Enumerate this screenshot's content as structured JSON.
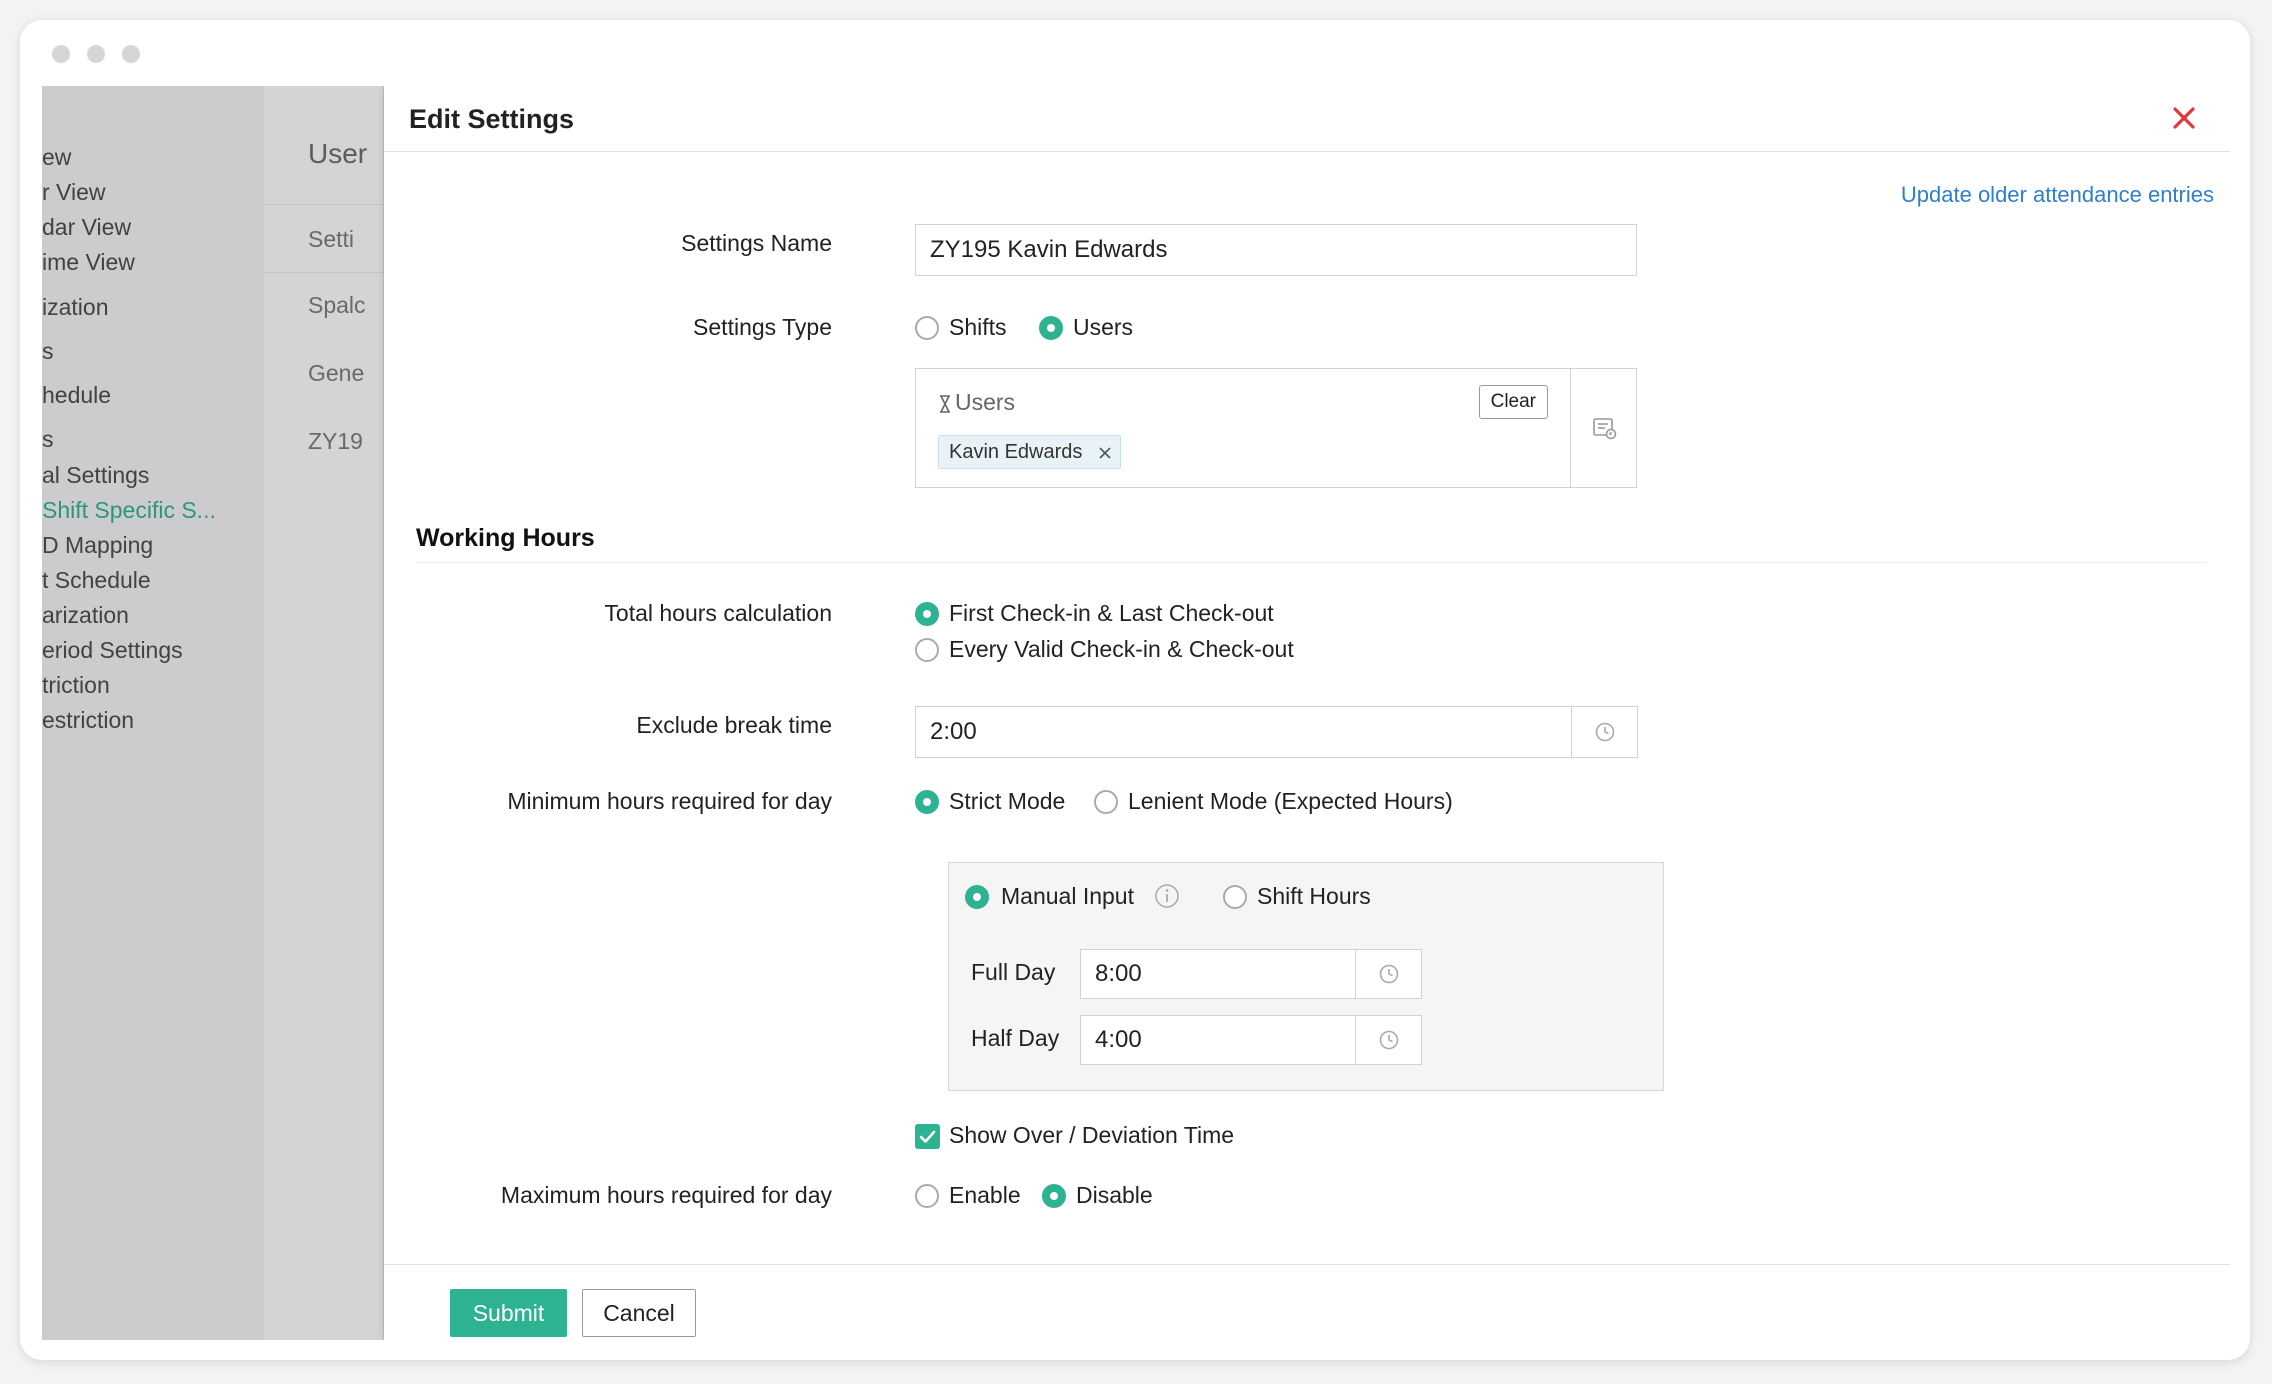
{
  "background": {
    "sidebar_items": [
      {
        "label": "ew",
        "active": false
      },
      {
        "label": "r View",
        "active": false
      },
      {
        "label": "dar View",
        "active": false
      },
      {
        "label": "ime View",
        "active": false
      },
      {
        "label": "ization",
        "active": false
      },
      {
        "label": "s",
        "active": false
      },
      {
        "label": "hedule",
        "active": false
      },
      {
        "label": "s",
        "active": false
      },
      {
        "label": "al Settings",
        "active": false
      },
      {
        "label": "Shift Specific S...",
        "active": true
      },
      {
        "label": "D Mapping",
        "active": false
      },
      {
        "label": "t Schedule",
        "active": false
      },
      {
        "label": "arization",
        "active": false
      },
      {
        "label": "eriod Settings",
        "active": false
      },
      {
        "label": "triction",
        "active": false
      },
      {
        "label": "estriction",
        "active": false
      }
    ],
    "list_header": "User",
    "list_items": [
      "Setti",
      "Spalc",
      "Gene",
      "ZY19"
    ]
  },
  "modal": {
    "title": "Edit Settings",
    "update_link": "Update older attendance entries",
    "settings_name": {
      "label": "Settings Name",
      "value": "ZY195 Kavin Edwards"
    },
    "settings_type": {
      "label": "Settings Type",
      "options": [
        "Shifts",
        "Users"
      ],
      "selected": "Users"
    },
    "users_box": {
      "header": "Users",
      "clear_label": "Clear",
      "selected": [
        "Kavin Edwards"
      ]
    },
    "working_hours": {
      "title": "Working Hours",
      "total_hours": {
        "label": "Total hours calculation",
        "options": [
          "First Check-in & Last Check-out",
          "Every Valid Check-in & Check-out"
        ],
        "selected": "First Check-in & Last Check-out"
      },
      "exclude_break": {
        "label": "Exclude break time",
        "value": "2:00"
      },
      "min_hours": {
        "label": "Minimum hours required for day",
        "options": [
          "Strict Mode",
          "Lenient Mode (Expected Hours)"
        ],
        "selected": "Strict Mode",
        "sub": {
          "options": [
            "Manual Input",
            "Shift Hours"
          ],
          "selected": "Manual Input",
          "full_day": {
            "label": "Full Day",
            "value": "8:00"
          },
          "half_day": {
            "label": "Half Day",
            "value": "4:00"
          }
        }
      },
      "show_over": {
        "label": "Show Over / Deviation Time",
        "checked": true
      },
      "max_hours": {
        "label": "Maximum hours required for day",
        "options": [
          "Enable",
          "Disable"
        ],
        "selected": "Disable"
      }
    },
    "footer": {
      "submit": "Submit",
      "cancel": "Cancel"
    }
  },
  "colors": {
    "accent": "#2db392",
    "link": "#2f7fd0",
    "close": "#e0383e"
  },
  "icons": [
    "close-icon",
    "clock-icon",
    "info-icon",
    "user-list-icon",
    "sort-icon",
    "remove-icon",
    "check-icon"
  ]
}
